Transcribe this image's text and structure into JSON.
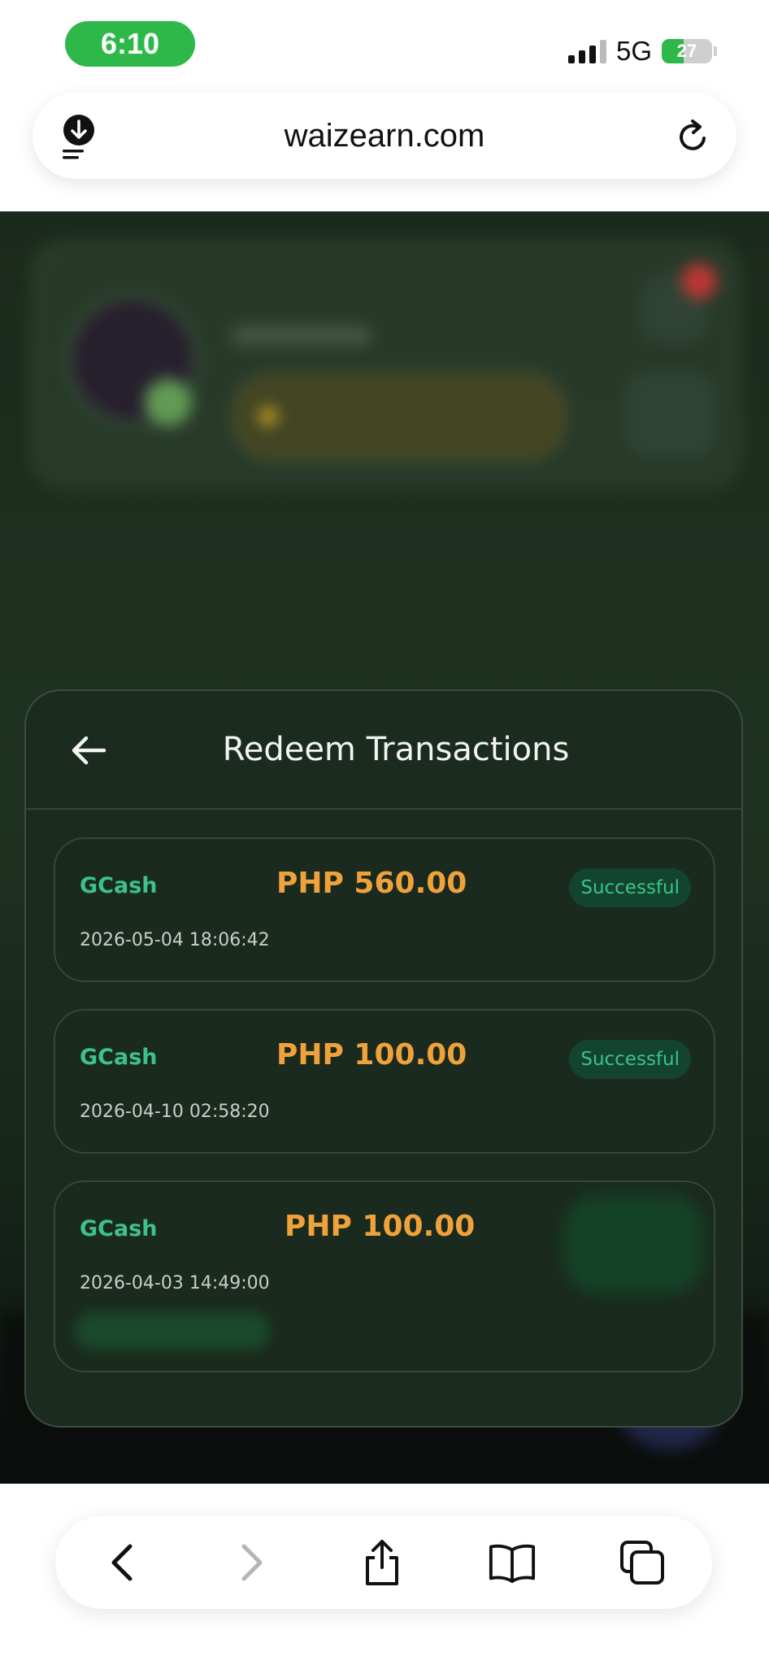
{
  "status_bar": {
    "time": "6:10",
    "network": "5G",
    "battery_level": "27",
    "battery_fraction": 0.27
  },
  "browser": {
    "url": "waizearn.com",
    "icons": {
      "left": "download-icon",
      "right": "reload-icon"
    }
  },
  "modal": {
    "title": "Redeem Transactions",
    "back_icon": "arrow-left-icon",
    "transactions": [
      {
        "method": "GCash",
        "amount": "PHP 560.00",
        "status": "Successful",
        "date": "2026-05-04 18:06:42"
      },
      {
        "method": "GCash",
        "amount": "PHP 100.00",
        "status": "Successful",
        "date": "2026-04-10 02:58:20"
      },
      {
        "method": "GCash",
        "amount": "PHP 100.00",
        "status": "",
        "date": "2026-04-03 14:49:00"
      }
    ]
  },
  "toolbar": {
    "buttons": [
      "back-icon",
      "forward-icon",
      "share-icon",
      "bookmarks-icon",
      "tabs-icon"
    ]
  },
  "colors": {
    "accent_green": "#3cc28a",
    "amount_orange": "#f0a23a",
    "status_bg": "#12442f",
    "time_pill": "#2fb84a"
  }
}
